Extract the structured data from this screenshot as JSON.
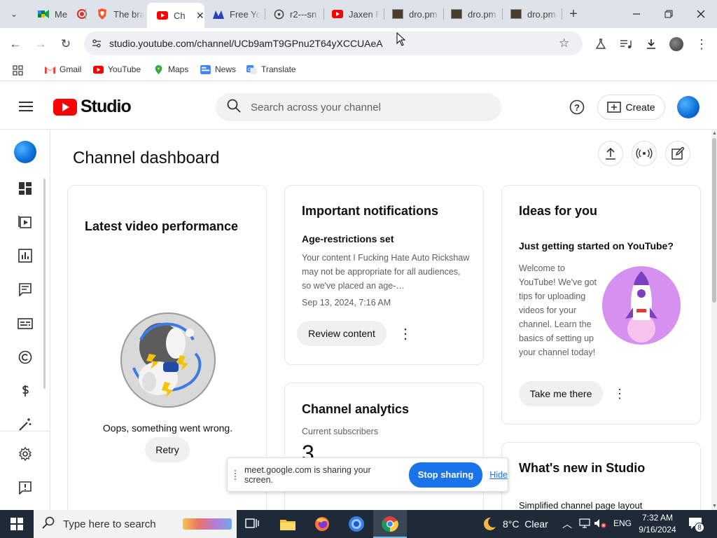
{
  "browser": {
    "tabs": [
      {
        "title": "Me",
        "favicon": "google-meet-icon"
      },
      {
        "title": "The bra",
        "favicon": "brave-icon"
      },
      {
        "title": "Ch",
        "favicon": "youtube-icon",
        "active": true
      },
      {
        "title": "Free Yo",
        "favicon": "site-icon"
      },
      {
        "title": "r2---sn",
        "favicon": "globe-icon"
      },
      {
        "title": "Jaxen R",
        "favicon": "youtube-icon"
      },
      {
        "title": "dro.pm",
        "favicon": "dro-icon"
      },
      {
        "title": "dro.pm",
        "favicon": "dro-icon"
      },
      {
        "title": "dro.pm",
        "favicon": "dro-icon"
      }
    ],
    "url": "studio.youtube.com/channel/UCb9amT9GPnu2T64yXCCUAeA",
    "bookmarks": [
      "Gmail",
      "YouTube",
      "Maps",
      "News",
      "Translate"
    ]
  },
  "studio": {
    "logo_text": "Studio",
    "search_placeholder": "Search across your channel",
    "create_label": "Create",
    "page_title": "Channel dashboard"
  },
  "cards": {
    "latest": {
      "title": "Latest video performance",
      "error": "Oops, something went wrong.",
      "retry": "Retry"
    },
    "notifications": {
      "title": "Important notifications",
      "subtitle": "Age-restrictions set",
      "body": "Your content I Fucking Hate Auto Rickshaw may not be appropriate for all audiences, so we've placed an age-…",
      "date": "Sep 13, 2024, 7:16 AM",
      "button": "Review content"
    },
    "analytics": {
      "title": "Channel analytics",
      "label": "Current subscribers",
      "value": "3"
    },
    "ideas": {
      "title": "Ideas for you",
      "subtitle": "Just getting started on YouTube?",
      "body": "Welcome to YouTube! We've got tips for uploading videos for your channel. Learn the basics of setting up your channel today!",
      "button": "Take me there"
    },
    "whatsnew": {
      "title": "What's new in Studio",
      "item": "Simplified channel page layout"
    }
  },
  "share_notice": {
    "text": "meet.google.com is sharing your screen.",
    "stop": "Stop sharing",
    "hide": "Hide"
  },
  "taskbar": {
    "search_placeholder": "Type here to search",
    "weather": "8°C  Clear",
    "lang": "ENG",
    "time": "7:32 AM",
    "date": "9/16/2024",
    "notifications": "8"
  },
  "colors": {
    "yt_red": "#ff0000",
    "accent_blue": "#065fd4",
    "taskbar": "#1f2a38"
  }
}
